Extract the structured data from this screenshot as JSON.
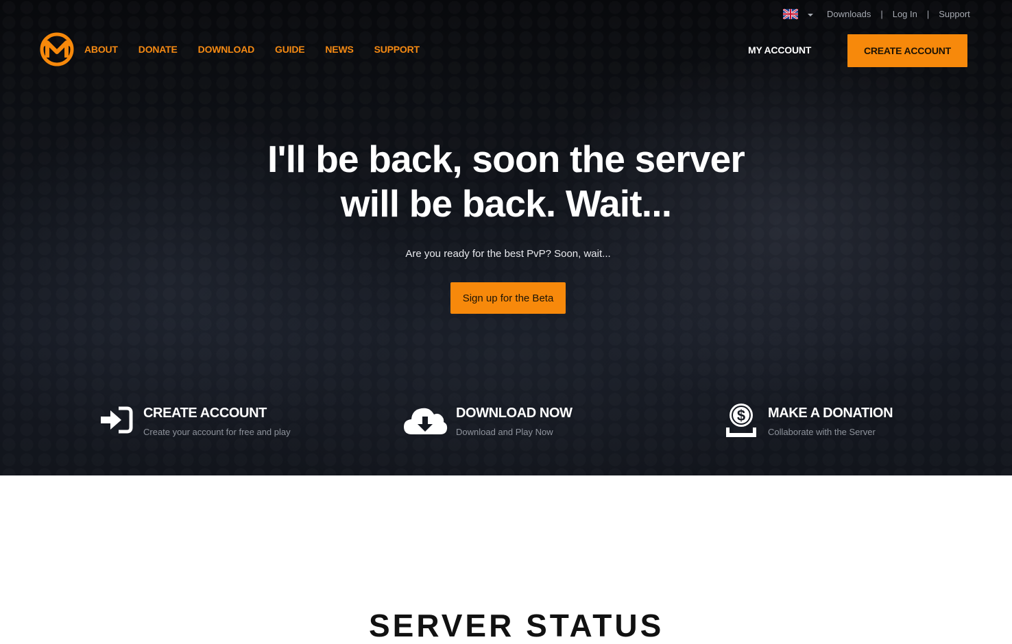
{
  "colors": {
    "accent": "#f7890b",
    "nav_text": "#f58a13",
    "hero_bg": "#0f1218",
    "white": "#ffffff"
  },
  "topbar": {
    "language_icon": "uk-flag-icon",
    "links": [
      "Downloads",
      "Log In",
      "Support"
    ],
    "separator": "|"
  },
  "nav": {
    "logo_icon": "m-logo-icon",
    "items": [
      "ABOUT",
      "DONATE",
      "DOWNLOAD",
      "GUIDE",
      "NEWS",
      "SUPPORT"
    ],
    "my_account": "MY ACCOUNT",
    "create_account": "CREATE ACCOUNT"
  },
  "hero": {
    "headline_line1": "I'll be back, soon the server",
    "headline_line2": "will be back. Wait...",
    "subline": "Are you ready for the best PvP? Soon, wait...",
    "cta": "Sign up for the Beta"
  },
  "features": [
    {
      "icon": "sign-in-icon",
      "title": "CREATE ACCOUNT",
      "subtitle": "Create your account for free and play"
    },
    {
      "icon": "cloud-download-icon",
      "title": "DOWNLOAD NOW",
      "subtitle": "Download and Play Now"
    },
    {
      "icon": "donation-coin-icon",
      "title": "MAKE A DONATION",
      "subtitle": "Collaborate with the Server"
    }
  ],
  "server_status": {
    "title": "SERVER STATUS"
  }
}
